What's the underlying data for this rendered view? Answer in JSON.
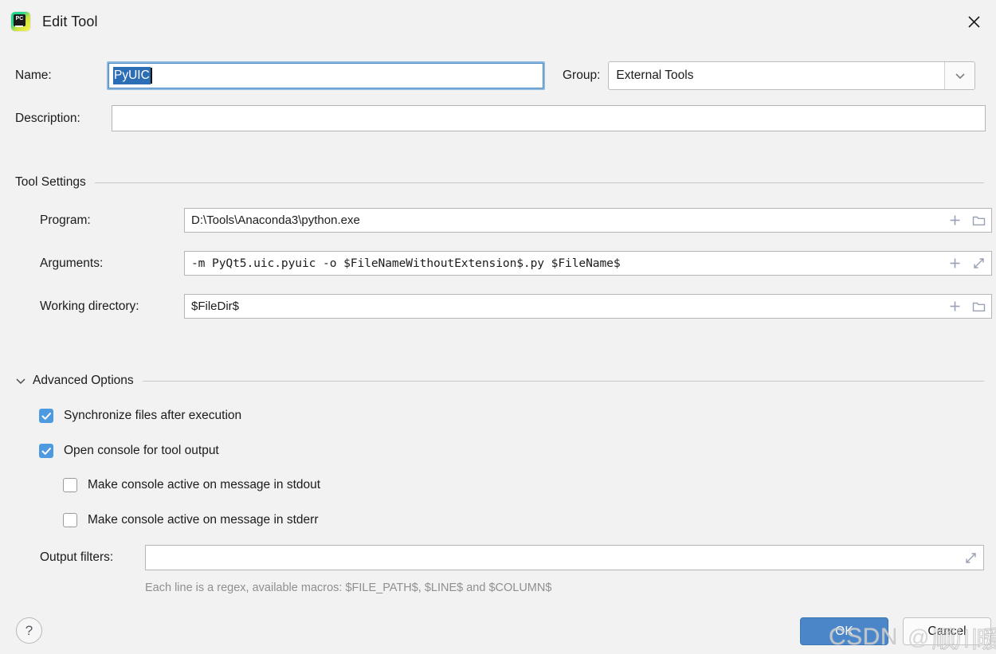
{
  "window": {
    "title": "Edit Tool",
    "app_icon": "pycharm-icon",
    "icon_text": "PC",
    "close_icon": "close-icon"
  },
  "form": {
    "name_label": "Name:",
    "name_value": "PyUIC",
    "group_label": "Group:",
    "group_value": "External Tools",
    "group_dropdown_icon": "chevron-down-icon",
    "description_label": "Description:",
    "description_value": "",
    "description_placeholder": ""
  },
  "tool_settings": {
    "section_title": "Tool Settings",
    "program_label": "Program:",
    "program_value": "D:\\Tools\\Anaconda3\\python.exe",
    "arguments_label": "Arguments:",
    "arguments_value": "-m PyQt5.uic.pyuic -o $FileNameWithoutExtension$.py $FileName$",
    "working_directory_label": "Working directory:",
    "working_directory_value": "$FileDir$",
    "insert_macro_icon": "plus-icon",
    "browse_icon": "folder-icon",
    "expand_icon": "expand-arrows-icon"
  },
  "advanced_options": {
    "section_title": "Advanced Options",
    "collapse_icon": "chevron-down-icon",
    "checkboxes": [
      {
        "label": "Synchronize files after execution",
        "checked": true
      },
      {
        "label": "Open console for tool output",
        "checked": true
      },
      {
        "label": "Make console active on message in stdout",
        "checked": false
      },
      {
        "label": "Make console active on message in stderr",
        "checked": false
      }
    ],
    "output_filters_label": "Output filters:",
    "output_filters_value": "",
    "output_filters_hint": "Each line is a regex, available macros: $FILE_PATH$, $LINE$ and $COLUMN$"
  },
  "footer": {
    "help_label": "?",
    "ok_label": "OK",
    "cancel_label": "Cancel"
  },
  "watermark": {
    "brand": "CSDN",
    "at": "@",
    "author": "顺川暖阳"
  },
  "colors": {
    "dialog_background": "#f2f2f2",
    "field_background": "#ffffff",
    "accent_blue": "#4a86c8",
    "selection_blue": "#2c6eb5",
    "checkbox_blue": "#4d9ae0",
    "focus_ring": "#8cb8e0",
    "hint_text": "#8f8f8f",
    "separator": "#c8c8c8"
  }
}
